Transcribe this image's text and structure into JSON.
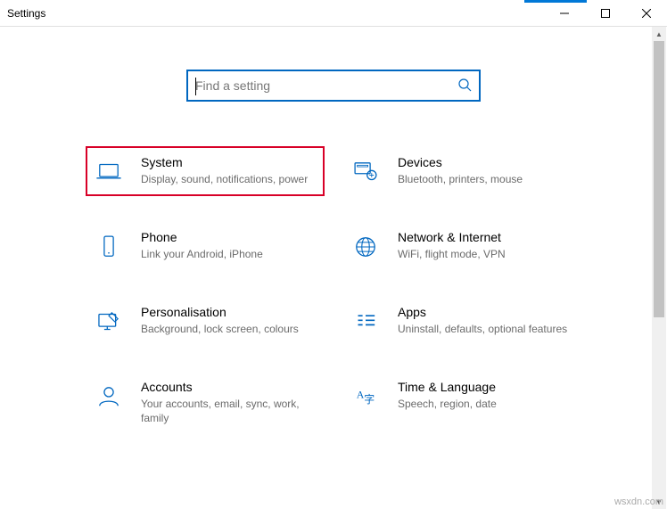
{
  "window": {
    "title": "Settings"
  },
  "search": {
    "placeholder": "Find a setting"
  },
  "tiles": {
    "system": {
      "title": "System",
      "desc": "Display, sound, notifications, power"
    },
    "devices": {
      "title": "Devices",
      "desc": "Bluetooth, printers, mouse"
    },
    "phone": {
      "title": "Phone",
      "desc": "Link your Android, iPhone"
    },
    "network": {
      "title": "Network & Internet",
      "desc": "WiFi, flight mode, VPN"
    },
    "personal": {
      "title": "Personalisation",
      "desc": "Background, lock screen, colours"
    },
    "apps": {
      "title": "Apps",
      "desc": "Uninstall, defaults, optional features"
    },
    "accounts": {
      "title": "Accounts",
      "desc": "Your accounts, email, sync, work, family"
    },
    "time": {
      "title": "Time & Language",
      "desc": "Speech, region, date"
    }
  },
  "colors": {
    "accent": "#0067c0",
    "highlight": "#d80027"
  },
  "watermark": "wsxdn.com"
}
